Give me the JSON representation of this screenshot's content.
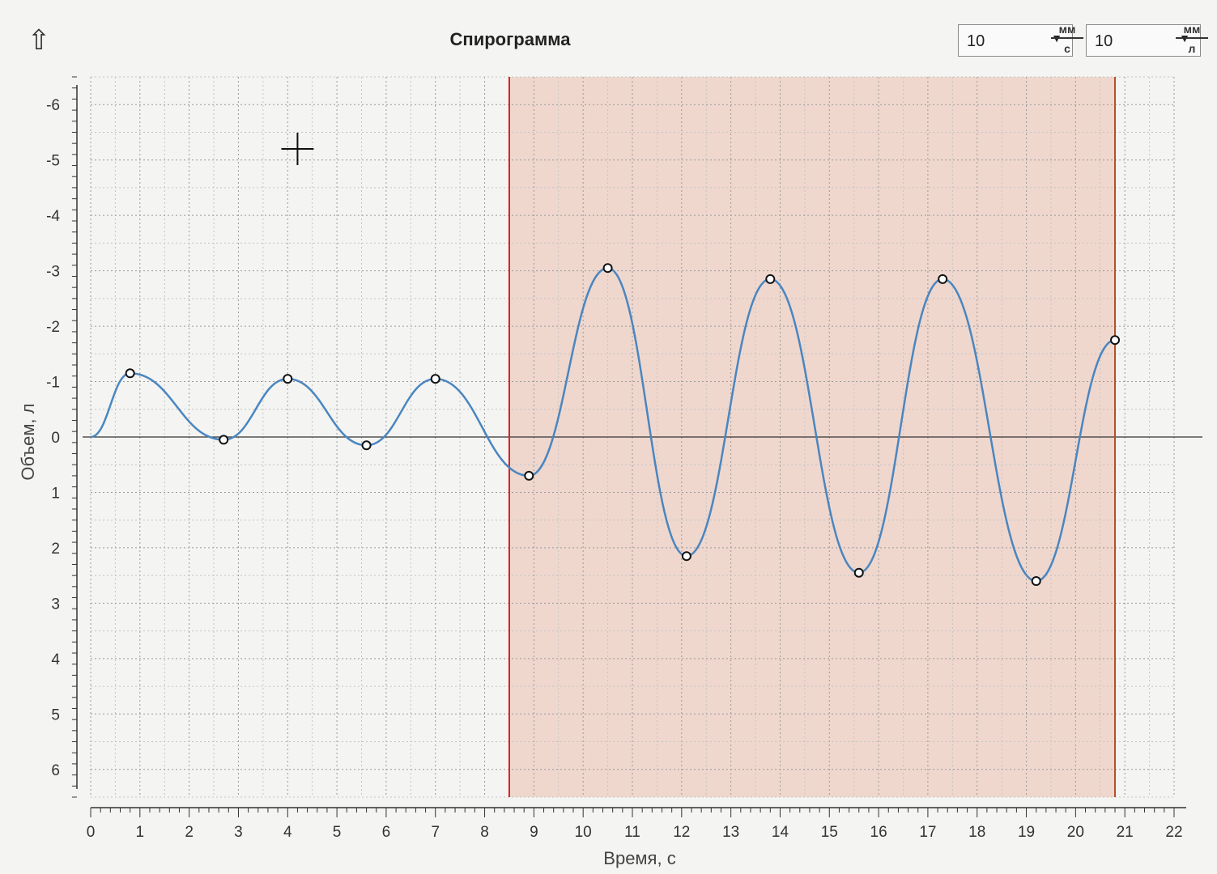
{
  "toolbar": {
    "up_icon": "arrow-up-icon",
    "title": "Спирограмма",
    "time_scale": {
      "value": "10",
      "unit_num": "мм",
      "unit_den": "с"
    },
    "volume_scale": {
      "value": "10",
      "unit_num": "мм",
      "unit_den": "л"
    }
  },
  "chart_data": {
    "type": "line",
    "title": "Спирограмма",
    "xlabel": "Время, с",
    "ylabel": "Объем, л",
    "xlim": [
      0,
      22
    ],
    "ylim": [
      -6.5,
      6.5
    ],
    "y_inverted": true,
    "grid": true,
    "x_ticks": [
      0,
      1,
      2,
      3,
      4,
      5,
      6,
      7,
      8,
      9,
      10,
      11,
      12,
      13,
      14,
      15,
      16,
      17,
      18,
      19,
      20,
      21,
      22
    ],
    "y_ticks": [
      -6,
      -5,
      -4,
      -3,
      -2,
      -1,
      0,
      1,
      2,
      3,
      4,
      5,
      6
    ],
    "series": [
      {
        "color": "#4a86c0",
        "x": [
          0,
          0.8,
          2.7,
          4.0,
          5.6,
          7.0,
          8.9,
          10.5,
          12.1,
          13.8,
          15.6,
          17.3,
          19.2,
          20.8
        ],
        "y": [
          0,
          -1.15,
          0.05,
          -1.05,
          0.15,
          -1.05,
          0.7,
          -3.05,
          2.15,
          -2.85,
          2.45,
          -2.85,
          2.6,
          -1.75
        ]
      }
    ],
    "selection": {
      "x_start": 8.5,
      "x_end": 20.8,
      "fill": "#e8b3a2",
      "edge_colors": [
        "#d92020",
        "#b05028"
      ]
    },
    "cursor_marker": {
      "x": 4.2,
      "y": -5.2
    }
  }
}
